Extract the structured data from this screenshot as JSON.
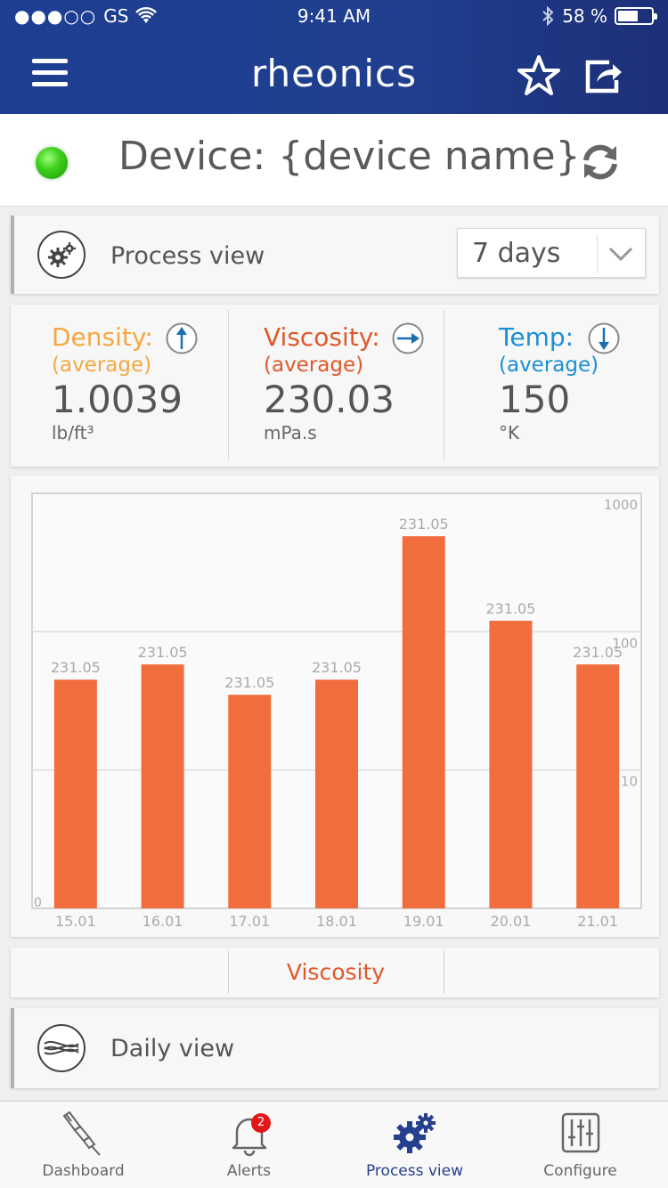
{
  "status_bar": {
    "carrier": "GS",
    "signal": "●●●○○",
    "time": "9:41 AM",
    "battery": "58 %"
  },
  "header": {
    "title": "rheonics"
  },
  "device": {
    "title": "Device: {device name}",
    "status_color": "#3fd11c"
  },
  "process_view": {
    "label": "Process view",
    "range": {
      "selected": "7 days"
    }
  },
  "metrics": [
    {
      "name": "Density:",
      "avg": "(average)",
      "value": "1.0039",
      "unit": "lb/ft³",
      "color": "#f5a742",
      "trend": "up"
    },
    {
      "name": "Viscosity:",
      "avg": "(average)",
      "value": "230.03",
      "unit": "mPa.s",
      "color": "#e0582a",
      "trend": "right"
    },
    {
      "name": "Temp:",
      "avg": "(average)",
      "value": "150",
      "unit": "°K",
      "color": "#1a8fd6",
      "trend": "down"
    }
  ],
  "chart_data": {
    "type": "bar",
    "categories": [
      "15.01",
      "16.01",
      "17.01",
      "18.01",
      "19.01",
      "20.01",
      "21.01"
    ],
    "values": [
      45,
      58,
      35,
      45,
      490,
      120,
      58
    ],
    "data_labels": [
      "231.05",
      "231.05",
      "231.05",
      "231.05",
      "231.05",
      "231.05",
      "231.05"
    ],
    "y_scale": "log",
    "y_ticks": [
      {
        "value": 10,
        "label": "10"
      },
      {
        "value": 100,
        "label": "100"
      },
      {
        "value": 1000,
        "label": "1000"
      }
    ],
    "y_origin_label": "0",
    "ylim": [
      1,
      1000
    ],
    "grid": true,
    "bar_color": "#f26d3d"
  },
  "tabs": {
    "left": "",
    "active": "Viscosity",
    "right": ""
  },
  "daily_view": {
    "label": "Daily view"
  },
  "bottom_nav": {
    "items": [
      {
        "label": "Dashboard"
      },
      {
        "label": "Alerts",
        "badge": "2"
      },
      {
        "label": "Process view"
      },
      {
        "label": "Configure"
      }
    ]
  }
}
